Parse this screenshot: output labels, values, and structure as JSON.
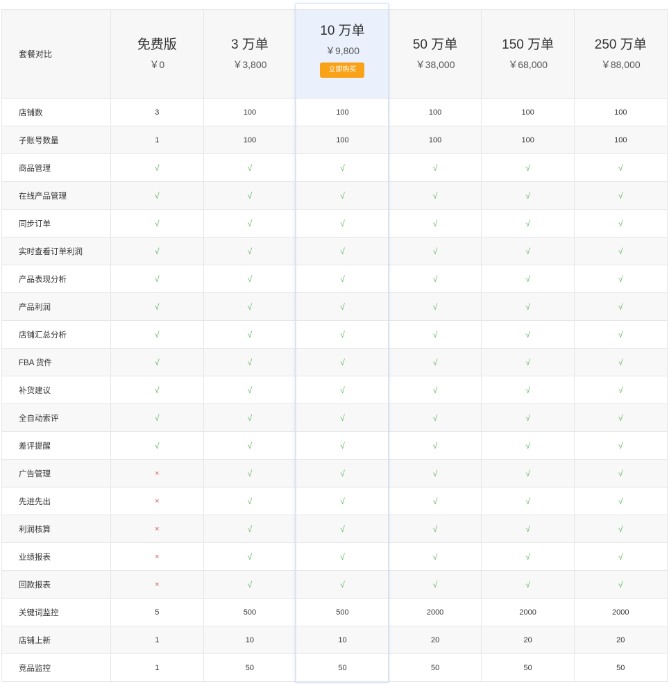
{
  "table": {
    "header_label": "套餐对比",
    "plans": [
      {
        "name": "免费版",
        "price": "￥0"
      },
      {
        "name": "3 万单",
        "price": "￥3,800"
      },
      {
        "name": "10 万单",
        "price": "￥9,800",
        "button": "立即购买",
        "highlight": true
      },
      {
        "name": "50 万单",
        "price": "￥38,000"
      },
      {
        "name": "150 万单",
        "price": "￥68,000"
      },
      {
        "name": "250 万单",
        "price": "￥88,000"
      }
    ],
    "rows": [
      {
        "feature": "店铺数",
        "values": [
          "3",
          "100",
          "100",
          "100",
          "100",
          "100"
        ]
      },
      {
        "feature": "子账号数量",
        "values": [
          "1",
          "100",
          "100",
          "100",
          "100",
          "100"
        ]
      },
      {
        "feature": "商品管理",
        "values": [
          "√",
          "√",
          "√",
          "√",
          "√",
          "√"
        ]
      },
      {
        "feature": "在线产品管理",
        "values": [
          "√",
          "√",
          "√",
          "√",
          "√",
          "√"
        ]
      },
      {
        "feature": "同步订单",
        "values": [
          "√",
          "√",
          "√",
          "√",
          "√",
          "√"
        ]
      },
      {
        "feature": "实时查看订单利润",
        "values": [
          "√",
          "√",
          "√",
          "√",
          "√",
          "√"
        ]
      },
      {
        "feature": "产品表现分析",
        "values": [
          "√",
          "√",
          "√",
          "√",
          "√",
          "√"
        ]
      },
      {
        "feature": "产品利润",
        "values": [
          "√",
          "√",
          "√",
          "√",
          "√",
          "√"
        ]
      },
      {
        "feature": "店铺汇总分析",
        "values": [
          "√",
          "√",
          "√",
          "√",
          "√",
          "√"
        ]
      },
      {
        "feature": "FBA 货件",
        "values": [
          "√",
          "√",
          "√",
          "√",
          "√",
          "√"
        ]
      },
      {
        "feature": "补货建议",
        "values": [
          "√",
          "√",
          "√",
          "√",
          "√",
          "√"
        ]
      },
      {
        "feature": "全自动索评",
        "values": [
          "√",
          "√",
          "√",
          "√",
          "√",
          "√"
        ]
      },
      {
        "feature": "差评提醒",
        "values": [
          "√",
          "√",
          "√",
          "√",
          "√",
          "√"
        ]
      },
      {
        "feature": "广告管理",
        "values": [
          "×",
          "√",
          "√",
          "√",
          "√",
          "√"
        ]
      },
      {
        "feature": "先进先出",
        "values": [
          "×",
          "√",
          "√",
          "√",
          "√",
          "√"
        ]
      },
      {
        "feature": "利润核算",
        "values": [
          "×",
          "√",
          "√",
          "√",
          "√",
          "√"
        ]
      },
      {
        "feature": "业绩报表",
        "values": [
          "×",
          "√",
          "√",
          "√",
          "√",
          "√"
        ]
      },
      {
        "feature": "回款报表",
        "values": [
          "×",
          "√",
          "√",
          "√",
          "√",
          "√"
        ]
      },
      {
        "feature": "关键词监控",
        "values": [
          "5",
          "500",
          "500",
          "2000",
          "2000",
          "2000"
        ]
      },
      {
        "feature": "店铺上新",
        "values": [
          "1",
          "10",
          "10",
          "20",
          "20",
          "20"
        ]
      },
      {
        "feature": "竞品监控",
        "values": [
          "1",
          "50",
          "50",
          "50",
          "50",
          "50"
        ]
      }
    ]
  },
  "colors": {
    "check": "#5cb85c",
    "cross": "#e05a5a",
    "buy_button": "#f9a217",
    "highlight_bg": "#eaf1fd"
  }
}
